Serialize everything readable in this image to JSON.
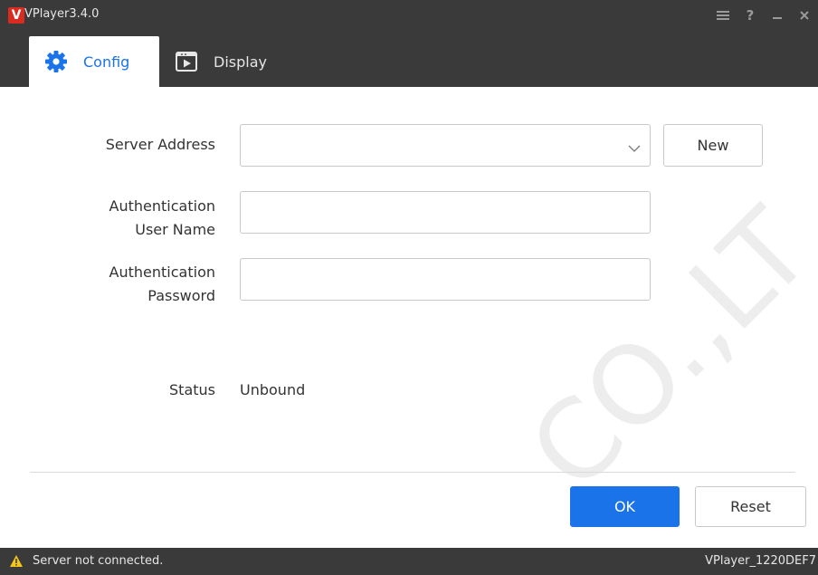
{
  "app": {
    "logo_letter": "V",
    "title": "VPlayer3.4.0"
  },
  "window_controls": {
    "menu_icon": "hamburger-menu-icon",
    "help_label": "?",
    "minimize_icon": "minimize-icon",
    "close_icon": "close-icon"
  },
  "tabs": [
    {
      "label": "Config",
      "icon": "gear-icon",
      "active": true
    },
    {
      "label": "Display",
      "icon": "display-play-icon",
      "active": false
    }
  ],
  "form": {
    "server_address_label": "Server Address",
    "server_address_value": "",
    "new_button_label": "New",
    "auth_user_label_line1": "Authentication",
    "auth_user_label_line2": "User Name",
    "auth_user_value": "",
    "auth_pass_label_line1": "Authentication",
    "auth_pass_label_line2": "Password",
    "auth_pass_value": "",
    "status_label": "Status",
    "status_value": "Unbound"
  },
  "actions": {
    "ok_label": "OK",
    "reset_label": "Reset"
  },
  "statusbar": {
    "message": "Server not connected.",
    "device_name": "VPlayer_1220DEF7"
  },
  "watermark_text": "CO.,LT",
  "colors": {
    "accent": "#1a73e8",
    "titlebar": "#3a3a3a",
    "logo": "#d92b20",
    "warning": "#f5c518"
  }
}
